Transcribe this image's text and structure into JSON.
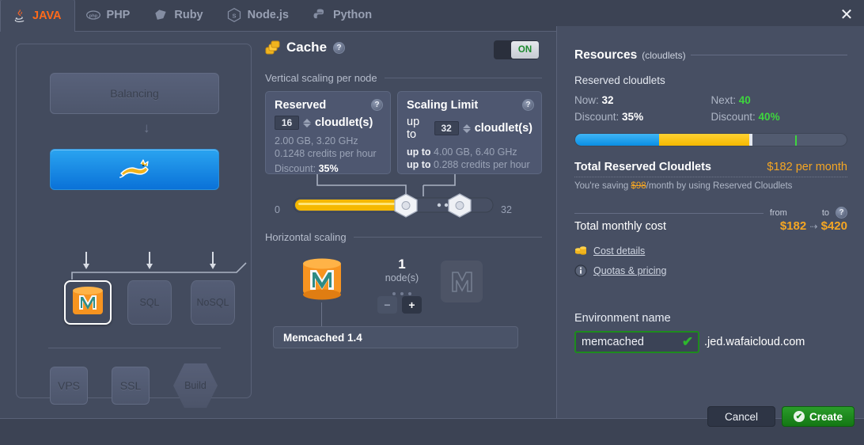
{
  "tabs": [
    {
      "label": "JAVA",
      "icon": "java-icon",
      "active": true
    },
    {
      "label": "PHP",
      "icon": "php-icon",
      "active": false
    },
    {
      "label": "Ruby",
      "icon": "ruby-icon",
      "active": false
    },
    {
      "label": "Node.js",
      "icon": "nodejs-icon",
      "active": false
    },
    {
      "label": "Python",
      "icon": "python-icon",
      "active": false
    }
  ],
  "window": {
    "close_label": "✕"
  },
  "topology": {
    "balancing_label": "Balancing",
    "app_server_icon": "tomcat-icon",
    "databases": [
      {
        "label": "",
        "icon": "memcached-icon",
        "selected": true
      },
      {
        "label": "SQL",
        "icon": "sql-db-icon",
        "selected": false
      },
      {
        "label": "NoSQL",
        "icon": "nosql-db-icon",
        "selected": false
      }
    ],
    "extras": [
      {
        "label": "VPS",
        "shape": "rounded"
      },
      {
        "label": "SSL",
        "shape": "rounded"
      },
      {
        "label": "Build",
        "shape": "hexagon"
      }
    ]
  },
  "cache": {
    "title": "Cache",
    "title_icon": "cache-stack-icon",
    "help_icon": "question-icon",
    "toggle_state": "ON",
    "vertical_section_label": "Vertical scaling per node",
    "reserved": {
      "title": "Reserved",
      "value": "16",
      "unit": "cloudlet(s)",
      "spec": "2.00 GB, 3.20 GHz",
      "credits": "0.1248 credits per hour",
      "discount_label": "Discount:",
      "discount_value": "35%"
    },
    "scaling_limit": {
      "title": "Scaling Limit",
      "prefix": "up to",
      "value": "32",
      "unit": "cloudlet(s)",
      "spec_prefix": "up to",
      "spec": "4.00 GB, 6.40 GHz",
      "credits_prefix": "up to",
      "credits": "0.288 credits per hour"
    },
    "slider": {
      "min_label": "0",
      "max_label": "32",
      "reserved_handle_value": 16,
      "limit_handle_value": 23,
      "min": 0,
      "max": 32
    },
    "horizontal_section_label": "Horizontal scaling",
    "node_count": "1",
    "node_unit": "node(s)",
    "minus_label": "−",
    "plus_label": "+",
    "stack_name": "Memcached 1.4",
    "node_icon": "memcached-node-icon",
    "ghost_node_icon": "memcached-ghost-icon"
  },
  "resources": {
    "title": "Resources",
    "title_suffix": "(cloudlets)",
    "reserved_label": "Reserved cloudlets",
    "now_label": "Now:",
    "now_value": "32",
    "now_discount_label": "Discount:",
    "now_discount_value": "35%",
    "next_label": "Next:",
    "next_value": "40",
    "next_discount_label": "Discount:",
    "next_discount_value": "40%",
    "bar": {
      "blue_pct": 31,
      "yellow_pct": 33,
      "handle_pct": 64,
      "tick_pct": 81
    },
    "total_reserved_label": "Total Reserved Cloudlets",
    "total_reserved_value": "$182 per month",
    "saving_prefix": "You're saving",
    "saving_value": "$98",
    "saving_suffix": "/month by using Reserved Cloudlets",
    "cost_from_label": "from",
    "cost_to_label": "to",
    "cost_help_icon": "question-icon",
    "total_monthly_label": "Total monthly cost",
    "cost_from_value": "$182",
    "cost_arrow": "⇢",
    "cost_to_value": "$420",
    "links": [
      {
        "label": "Cost details",
        "icon": "coins-icon"
      },
      {
        "label": "Quotas & pricing",
        "icon": "info-icon"
      }
    ]
  },
  "environment": {
    "label": "Environment name",
    "value": "memcached",
    "placeholder": "Environment name",
    "valid_icon": "check-icon",
    "domain_suffix": ".jed.wafaicloud.com"
  },
  "footer": {
    "cancel_label": "Cancel",
    "create_label": "Create",
    "create_icon": "check-circle-icon"
  },
  "colors": {
    "accent_orange": "#ff6a1a",
    "amber": "#f5a623",
    "green": "#3ed63e",
    "blue": "#0a8ee4",
    "bg": "#434b5e"
  }
}
